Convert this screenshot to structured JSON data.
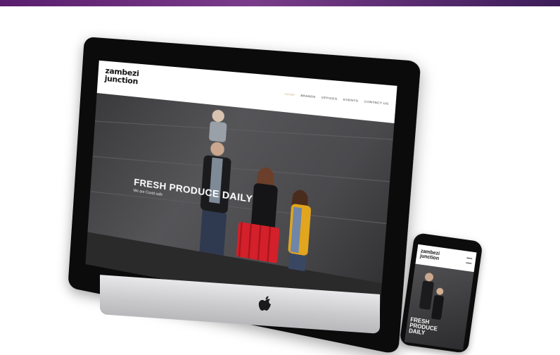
{
  "site": {
    "logo_line1": "zambezi",
    "logo_line2": "junction",
    "nav": [
      "HOME",
      "BRANDS",
      "OFFICES",
      "EVENTS",
      "CONTACT US"
    ],
    "hero_title": "FRESH PRODUCE DAILY",
    "hero_subtitle": "We are Covid safe"
  },
  "phone": {
    "logo_line1": "zambezi",
    "logo_line2": "junction",
    "hero_title": "FRESH PRODUCE DAILY"
  },
  "icons": [
    "apple-logo-icon",
    "hamburger-menu-icon"
  ],
  "colors": {
    "top_strip_start": "#5a1e6e",
    "top_strip_end": "#3c1d58",
    "bezel": "#0b0b0c",
    "chin": "#d2d2d5",
    "nav_active": "#c9b88a",
    "cart_red": "#d3202a",
    "jacket_yellow": "#e2a51e"
  }
}
